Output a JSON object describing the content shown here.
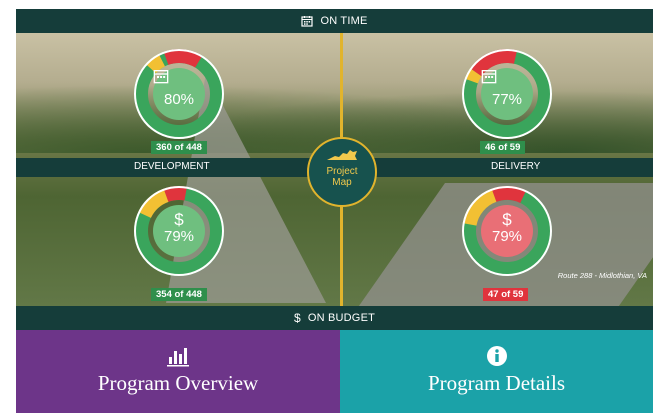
{
  "header": {
    "title": "ON TIME",
    "icon": "calendar-icon"
  },
  "footer_bar": {
    "title": "ON BUDGET",
    "icon": "dollar-icon"
  },
  "sections": {
    "development": "DEVELOPMENT",
    "delivery": "DELIVERY"
  },
  "map_button": {
    "line1": "Project",
    "line2": "Map",
    "icon": "virginia-state-icon"
  },
  "gauges": [
    {
      "id": "dev-time",
      "percent": "80%",
      "count": "360 of 448",
      "icon": "calendar-icon",
      "fill": 0.8,
      "color": "#6fbf7f"
    },
    {
      "id": "del-time",
      "percent": "77%",
      "count": "46 of 59",
      "icon": "calendar-icon",
      "fill": 0.77,
      "color": "#6fbf7f"
    },
    {
      "id": "dev-budget",
      "percent": "79%",
      "count": "354 of 448",
      "icon": "dollar-icon",
      "fill": 0.79,
      "color": "#6fbf7f"
    },
    {
      "id": "del-budget",
      "percent": "79%",
      "count": "47 of 59",
      "icon": "dollar-icon",
      "fill": 0.79,
      "color": "#e96f76"
    }
  ],
  "caption": "Route 288 - Midlothian, VA",
  "tiles": {
    "overview": {
      "label": "Program Overview",
      "icon": "bar-chart-icon"
    },
    "details": {
      "label": "Program Details",
      "icon": "info-icon"
    }
  },
  "colors": {
    "dark": "#153d3a",
    "gold": "#e1b42d",
    "purple": "#6d3589",
    "teal": "#1ba2a8",
    "green": "#3aa55c",
    "yellow": "#f2c033",
    "red": "#e0343d"
  }
}
